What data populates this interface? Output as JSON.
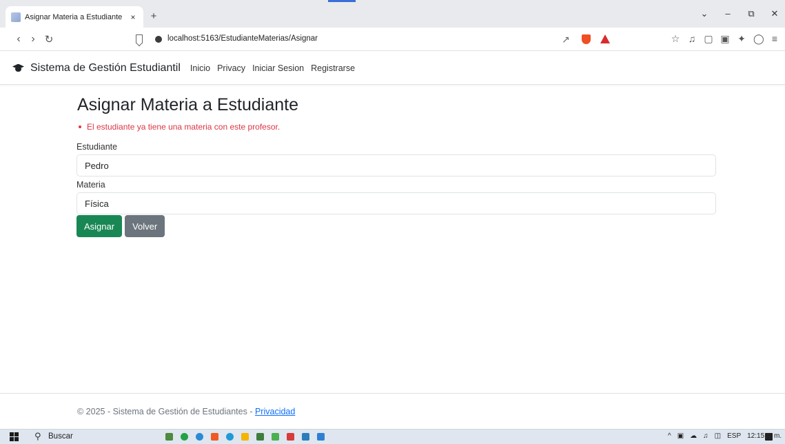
{
  "browser": {
    "tab_title": "Asignar Materia a Estudiante - ",
    "tab_close": "×",
    "new_tab": "+",
    "url": "localhost:5163/EstudianteMaterias/Asignar",
    "window_controls": {
      "chevron": "⌄",
      "minimize": "–",
      "restore": "⧉",
      "close": "✕"
    }
  },
  "navbar": {
    "brand": "Sistema de Gestión Estudiantil",
    "links": [
      "Inicio",
      "Privacy",
      "Iniciar Sesion",
      "Registrarse"
    ]
  },
  "page": {
    "title": "Asignar Materia a Estudiante",
    "errors": [
      "El estudiante ya tiene una materia con este profesor."
    ],
    "fields": {
      "student_label": "Estudiante",
      "student_value": "Pedro",
      "subject_label": "Materia",
      "subject_value": "Física"
    },
    "buttons": {
      "assign": "Asignar",
      "back": "Volver"
    }
  },
  "footer": {
    "text": "© 2025 - Sistema de Gestión de Estudiantes - ",
    "link": "Privacidad"
  },
  "taskbar": {
    "search": "Buscar",
    "language": "ESP",
    "time": "12:15 a. m."
  },
  "colors": {
    "success": "#198754",
    "secondary": "#6c757d",
    "danger": "#dc3545",
    "link": "#0d6efd"
  }
}
